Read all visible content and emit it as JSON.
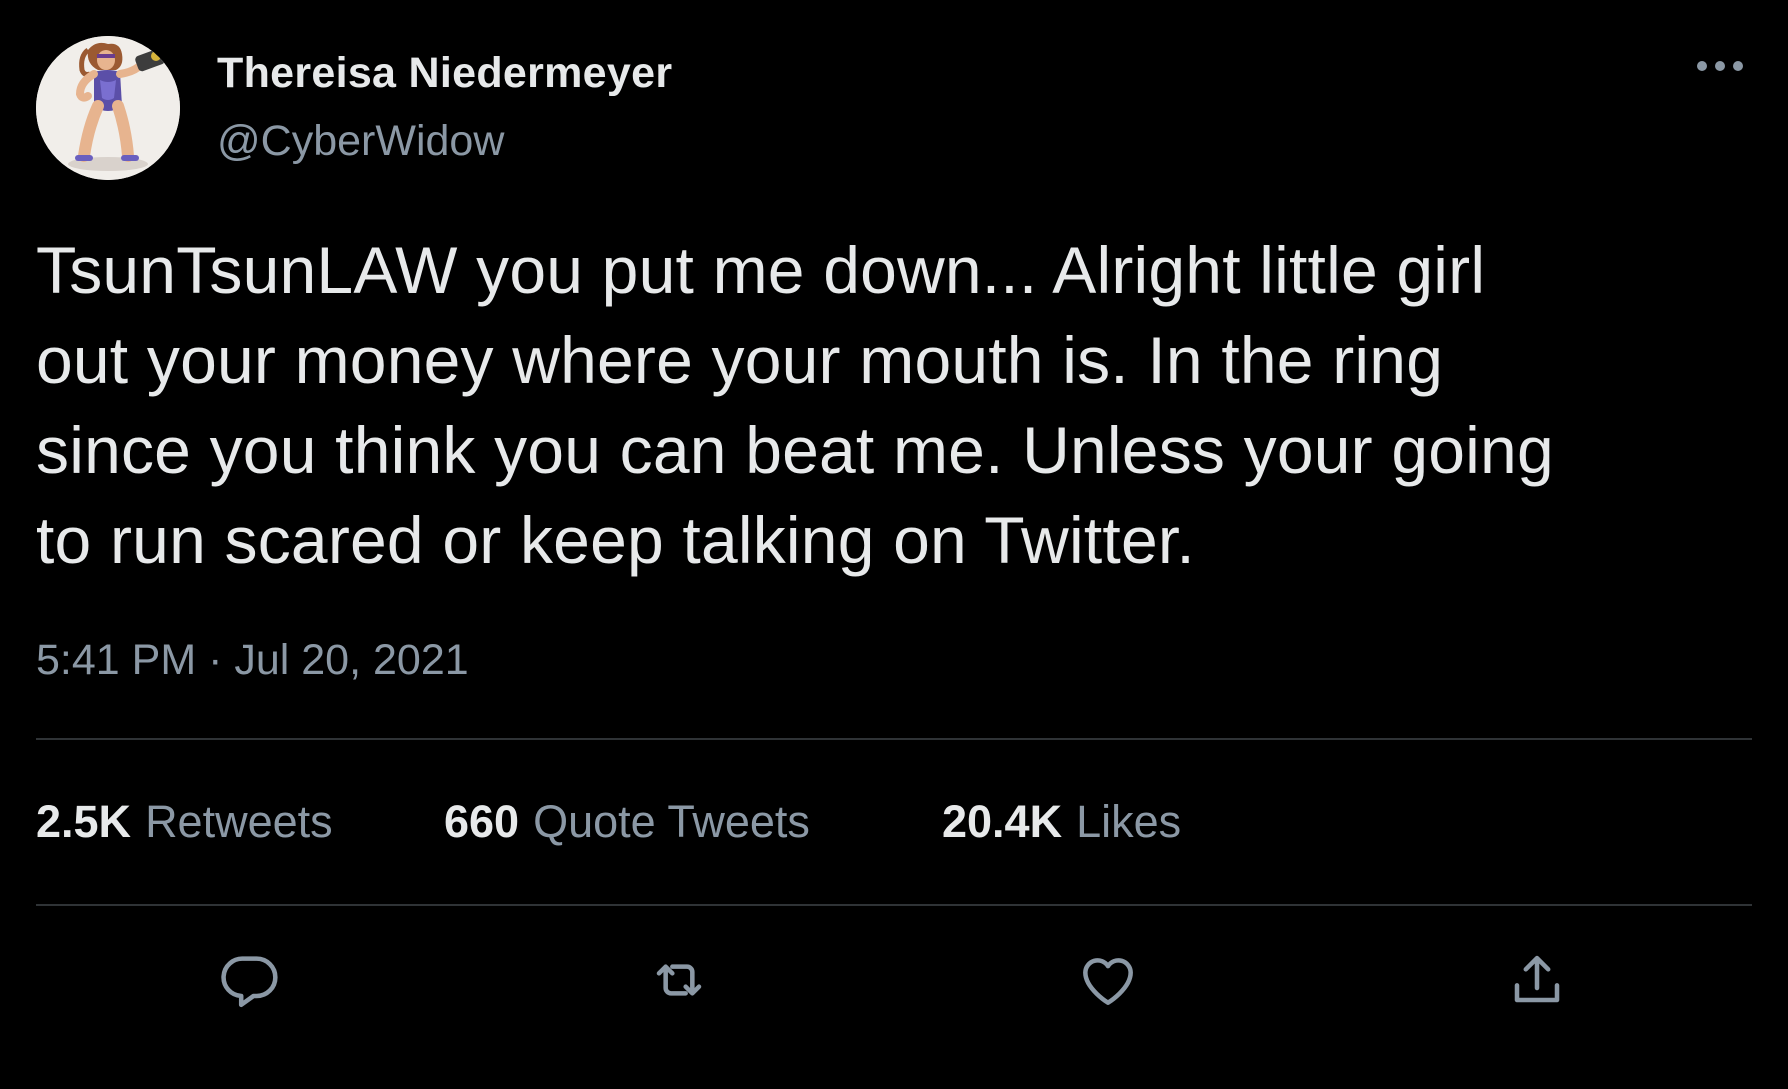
{
  "author": {
    "display_name": "Thereisa Niedermeyer",
    "handle": "@CyberWidow",
    "avatar_icon": "avatar-image"
  },
  "tweet": {
    "text": "TsunTsunLAW you put me down... Alright little girl\nout your money where your mouth is. In the ring\nsince you think you can beat me. Unless your going\nto run scared or keep talking on Twitter.",
    "timestamp": "5:41 PM · Jul 20, 2021"
  },
  "stats": {
    "retweets": {
      "count": "2.5K",
      "label": "Retweets"
    },
    "quote_tweets": {
      "count": "660",
      "label": "Quote Tweets"
    },
    "likes": {
      "count": "20.4K",
      "label": "Likes"
    }
  },
  "actions": [
    {
      "name": "reply",
      "icon": "reply-icon"
    },
    {
      "name": "retweet",
      "icon": "retweet-icon"
    },
    {
      "name": "like",
      "icon": "heart-icon"
    },
    {
      "name": "share",
      "icon": "share-icon"
    }
  ],
  "colors": {
    "background": "#000000",
    "primary_text": "#e7e9ea",
    "secondary_text": "#8b98a5",
    "divider": "#2f3336"
  }
}
